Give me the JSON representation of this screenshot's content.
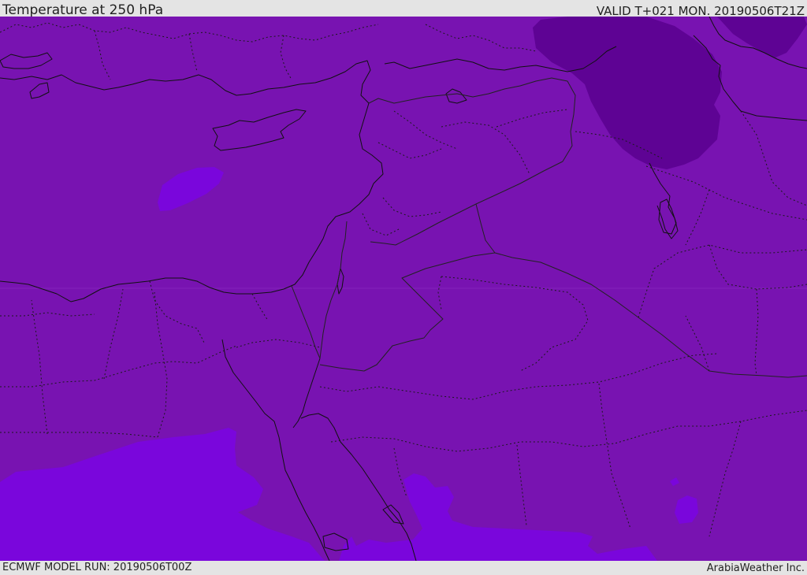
{
  "header": {
    "title": "Temperature at 250 hPa",
    "valid_time": "VALID T+021 MON. 20190506T21Z"
  },
  "footer": {
    "model_run": "ECMWF MODEL RUN: 20190506T00Z",
    "credit": "ArabiaWeather Inc."
  },
  "map": {
    "region": "Eastern Mediterranean and Middle East",
    "field": "temperature",
    "level": "250 hPa",
    "colors": {
      "base": "#7813b1",
      "warm_patch": "#7a06dc",
      "cold_patch": "#5e0394",
      "coldest_patch": "#53008a",
      "coastline": "#111111",
      "border": "#222222"
    }
  }
}
